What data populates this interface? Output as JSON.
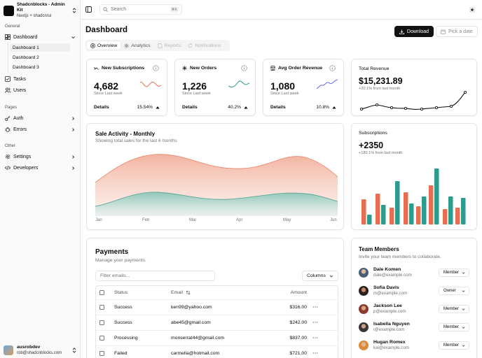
{
  "brand": {
    "name": "Shadcnblocks - Admin Kit",
    "sub": "Nextjs + shadcn/ui"
  },
  "sidebar": {
    "general_label": "General",
    "dashboard": "Dashboard",
    "sub_items": [
      "Dashboard 1",
      "Dashboard 2",
      "Dashboard 3"
    ],
    "tasks": "Tasks",
    "users": "Users",
    "pages_label": "Pages",
    "auth": "Auth",
    "errors": "Errors",
    "other_label": "Other",
    "settings": "Settings",
    "developers": "Developers"
  },
  "user": {
    "name": "ausrobdev",
    "email": "rob@shadcnblocks.com"
  },
  "topbar": {
    "search_placeholder": "Search",
    "search_shortcut": "⌘K"
  },
  "page": {
    "title": "Dashboard",
    "download": "Download",
    "pick_date": "Pick a date",
    "tabs": [
      "Overview",
      "Analytics",
      "Reports",
      "Notifications"
    ]
  },
  "stats": [
    {
      "title": "New Subscriptions",
      "value": "4,682",
      "sub": "Since Last week",
      "footer": "Details",
      "pct": "15.54%",
      "color": "#e76e50"
    },
    {
      "title": "New Orders",
      "value": "1,226",
      "sub": "Since Last week",
      "footer": "Details",
      "pct": "40.2%",
      "color": "#2a9d8f"
    },
    {
      "title": "Avg Order Revenue",
      "value": "1,080",
      "sub": "Since Last week",
      "footer": "Details",
      "pct": "10.8%",
      "color": "#6366f1"
    }
  ],
  "revenue": {
    "label": "Total Revenue",
    "value": "$15,231.89",
    "sub": "+20.1% from last month"
  },
  "sales": {
    "title": "Sale Activity - Monthly",
    "desc": "Showing total sales for the last 6 months",
    "months": [
      "Jan",
      "Feb",
      "Mar",
      "Apr",
      "May",
      "Jun"
    ]
  },
  "subscriptions": {
    "label": "Subscriptions",
    "value": "+2350",
    "sub": "+180.1% from last month"
  },
  "payments": {
    "title": "Payments",
    "desc": "Manage your payments.",
    "filter_placeholder": "Filter emails...",
    "columns_btn": "Columns",
    "headers": {
      "status": "Status",
      "email": "Email",
      "amount": "Amount"
    },
    "rows": [
      {
        "status": "Success",
        "email": "ken99@yahoo.com",
        "amount": "$316.00"
      },
      {
        "status": "Success",
        "email": "abe45@gmail.com",
        "amount": "$242.00"
      },
      {
        "status": "Processing",
        "email": "monserrat44@gmail.com",
        "amount": "$837.00"
      },
      {
        "status": "Failed",
        "email": "carmella@hotmail.com",
        "amount": "$721.00"
      }
    ],
    "more": "···"
  },
  "team": {
    "title": "Team Members",
    "desc": "Invite your team members to collaborate.",
    "members": [
      {
        "name": "Dale Komen",
        "email": "dale@example.com",
        "role": "Member"
      },
      {
        "name": "Sofia Davis",
        "email": "m@example.com",
        "role": "Owner"
      },
      {
        "name": "Jackson Lee",
        "email": "p@example.com",
        "role": "Member"
      },
      {
        "name": "Isabella Nguyen",
        "email": "i@example.com",
        "role": "Member"
      },
      {
        "name": "Hugan Romex",
        "email": "kai@example.com",
        "role": "Member"
      }
    ]
  },
  "colors": {
    "accent_orange": "#e76e50",
    "accent_teal": "#2a9d8f",
    "accent_indigo": "#6366f1"
  }
}
